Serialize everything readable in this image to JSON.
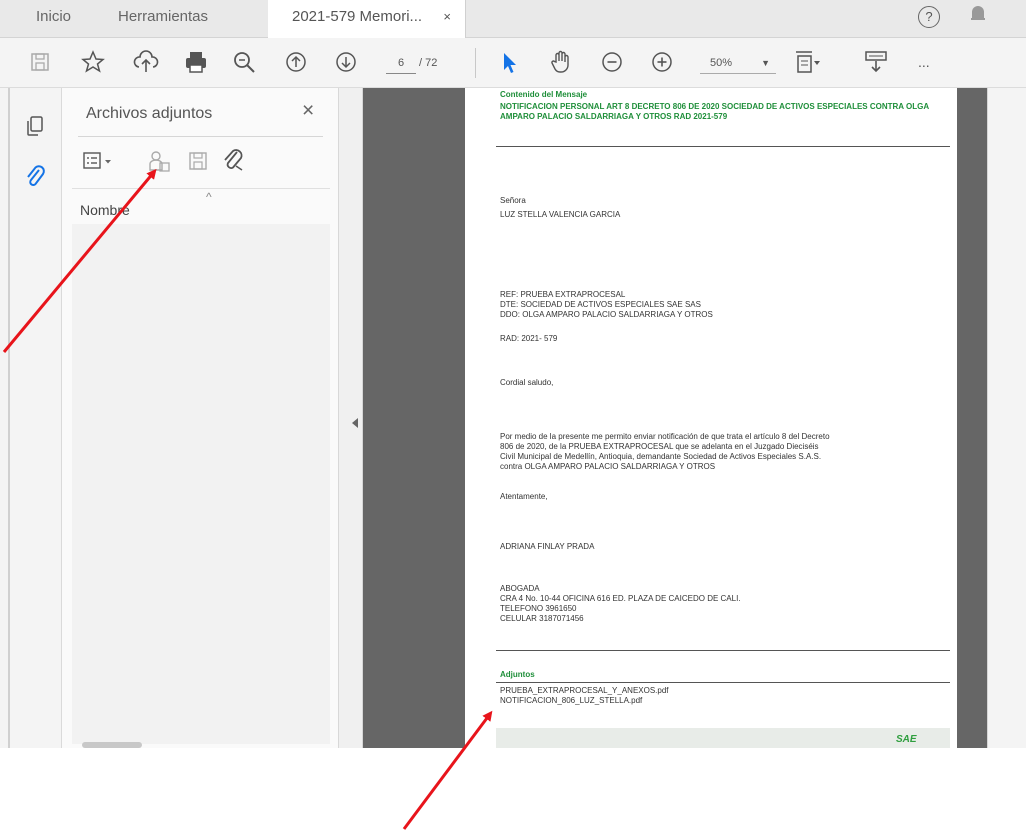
{
  "tabs": {
    "home": "Inicio",
    "tools": "Herramientas",
    "document": "2021-579 Memori...",
    "close": "×"
  },
  "toolbar": {
    "current_page": "6",
    "total_pages": "/ 72",
    "zoom": "50%",
    "more": "..."
  },
  "panel": {
    "title": "Archivos adjuntos",
    "close": "×",
    "column_header": "Nombre"
  },
  "document": {
    "message_label": "Contenido del Mensaje",
    "subject": "NOTIFICACION PERSONAL ART 8 DECRETO 806 DE 2020 SOCIEDAD DE ACTIVOS ESPECIALES CONTRA OLGA AMPARO PALACIO SALDARRIAGA Y OTROS RAD 2021-579",
    "salutation": "Señora",
    "recipient": "LUZ STELLA VALENCIA GARCIA",
    "ref_lines": "REF: PRUEBA EXTRAPROCESAL\nDTE: SOCIEDAD DE ACTIVOS ESPECIALES SAE SAS\nDDO: OLGA AMPARO PALACIO SALDARRIAGA Y OTROS",
    "rad": "RAD: 2021- 579",
    "greeting": "Cordial saludo,",
    "body": "Por medio de la presente me permito enviar notificación de que trata el artículo 8 del Decreto\n806 de 2020, de la PRUEBA EXTRAPROCESAL que se adelanta en el Juzgado Dieciséis\nCivil Municipal de Medellín, Antioquia, demandante Sociedad de Activos Especiales S.A.S.\ncontra OLGA AMPARO PALACIO SALDARRIAGA Y OTROS",
    "closing": "Atentamente,",
    "signer": "ADRIANA FINLAY PRADA",
    "signature_block": "ABOGADA\nCRA 4 No. 10-44 OFICINA 616 ED. PLAZA DE CAICEDO DE CALI.\nTELEFONO 3961650\nCELULAR 3187071456",
    "attachments_label": "Adjuntos",
    "attachment_1": "PRUEBA_EXTRAPROCESAL_Y_ANEXOS.pdf",
    "attachment_2": "NOTIFICACION_806_LUZ_STELLA.pdf",
    "stamp": "SAE"
  },
  "icons": {
    "toolbar": [
      "save-icon",
      "bookmark-star-icon",
      "upload-cloud-icon",
      "print-icon",
      "zoom-search-icon",
      "page-up-icon",
      "page-down-icon",
      "select-arrow-icon",
      "hand-icon",
      "zoom-out-icon",
      "zoom-in-icon",
      "fit-page-icon",
      "scroll-mode-icon",
      "more-icon"
    ],
    "panel": [
      "options-list-icon",
      "add-attachment-icon",
      "save-attachment-icon",
      "attach-file-icon"
    ],
    "nav": [
      "pages-icon",
      "paperclip-icon"
    ]
  },
  "colors": {
    "accent": "#1473e6",
    "document_green": "#1f8f3a",
    "annotation_arrow": "#e8141b",
    "viewport_gray": "#666666"
  }
}
